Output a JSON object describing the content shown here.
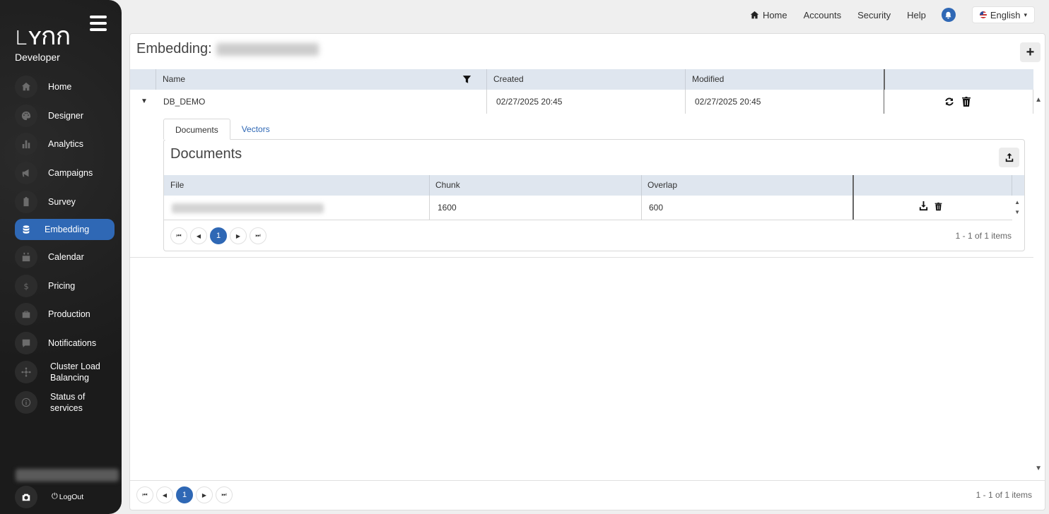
{
  "sidebar": {
    "brand": "LYNN",
    "role": "Developer",
    "items": [
      {
        "label": "Home",
        "icon": "home-icon"
      },
      {
        "label": "Designer",
        "icon": "palette-icon"
      },
      {
        "label": "Analytics",
        "icon": "bar-chart-icon"
      },
      {
        "label": "Campaigns",
        "icon": "megaphone-icon"
      },
      {
        "label": "Survey",
        "icon": "clipboard-icon"
      },
      {
        "label": "Embedding",
        "icon": "database-icon",
        "active": true
      },
      {
        "label": "Calendar",
        "icon": "calendar-icon"
      },
      {
        "label": "Pricing",
        "icon": "dollar-icon"
      },
      {
        "label": "Production",
        "icon": "briefcase-icon"
      },
      {
        "label": "Notifications",
        "icon": "message-icon"
      },
      {
        "label": "Cluster Load Balancing",
        "icon": "network-icon"
      },
      {
        "label": "Status of services",
        "icon": "info-icon"
      }
    ],
    "logout_label": "LogOut"
  },
  "topnav": {
    "home": "Home",
    "accounts": "Accounts",
    "security": "Security",
    "help": "Help",
    "language": "English"
  },
  "page": {
    "title": "Embedding:"
  },
  "grid": {
    "columns": [
      "Name",
      "Created",
      "Modified"
    ],
    "rows": [
      {
        "name": "DB_DEMO",
        "created": "02/27/2025 20:45",
        "modified": "02/27/2025 20:45"
      }
    ],
    "pager": {
      "current": "1",
      "info": "1 - 1 of 1 items"
    }
  },
  "detail": {
    "tabs": [
      "Documents",
      "Vectors"
    ],
    "panel_title": "Documents",
    "columns": [
      "File",
      "Chunk",
      "Overlap"
    ],
    "rows": [
      {
        "chunk": "1600",
        "overlap": "600"
      }
    ],
    "pager": {
      "current": "1",
      "info": "1 - 1 of 1 items"
    }
  },
  "colors": {
    "accent": "#2f68b5",
    "sidebar_bg": "#1d1d1d",
    "grid_header": "#dfe6ef"
  }
}
